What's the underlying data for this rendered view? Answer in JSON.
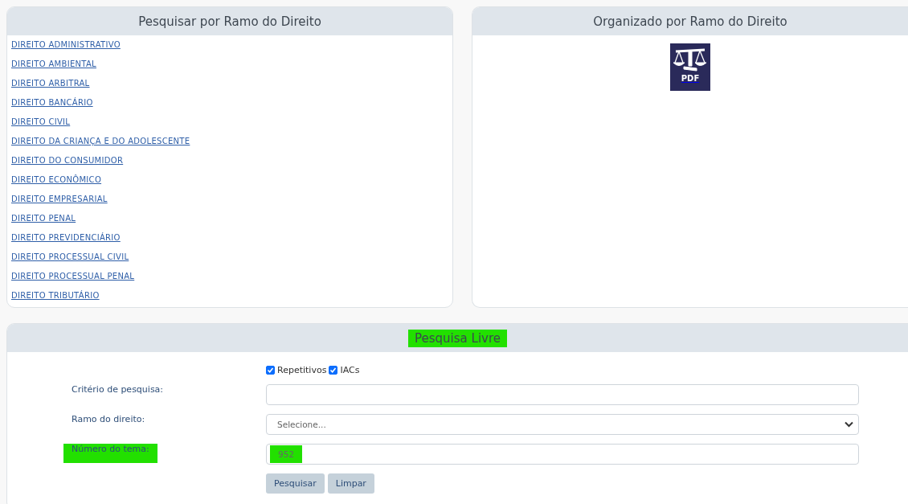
{
  "branch_panel": {
    "title": "Pesquisar por Ramo do Direito",
    "links": [
      "DIREITO ADMINISTRATIVO",
      "DIREITO AMBIENTAL",
      "DIREITO ARBITRAL",
      "DIREITO BANCÁRIO",
      "DIREITO CIVIL",
      "DIREITO DA CRIANÇA E DO ADOLESCENTE",
      "DIREITO DO CONSUMIDOR",
      "DIREITO ECONÔMICO",
      "DIREITO EMPRESARIAL",
      "DIREITO PENAL",
      "DIREITO PREVIDENCIÁRIO",
      "DIREITO PROCESSUAL CIVIL",
      "DIREITO PROCESSUAL PENAL",
      "DIREITO TRIBUTÁRIO"
    ]
  },
  "organized_panel": {
    "title": "Organizado por Ramo do Direito",
    "pdf_label": "PDF"
  },
  "free_search": {
    "title": "Pesquisa Livre",
    "title_highlighted": true,
    "checkboxes": [
      {
        "label": "Repetitivos",
        "checked": true
      },
      {
        "label": "IACs",
        "checked": true
      }
    ],
    "fields": [
      {
        "kind": "text",
        "label": "Critério de pesquisa:",
        "label_highlighted": false
      },
      {
        "kind": "select",
        "label": "Ramo do direito:",
        "value": "Selecione...",
        "label_highlighted": false
      },
      {
        "kind": "text",
        "label": "Número do tema:",
        "value": "952",
        "label_highlighted": true,
        "value_highlighted": true
      }
    ],
    "buttons": [
      "Pesquisar",
      "Limpar"
    ]
  }
}
